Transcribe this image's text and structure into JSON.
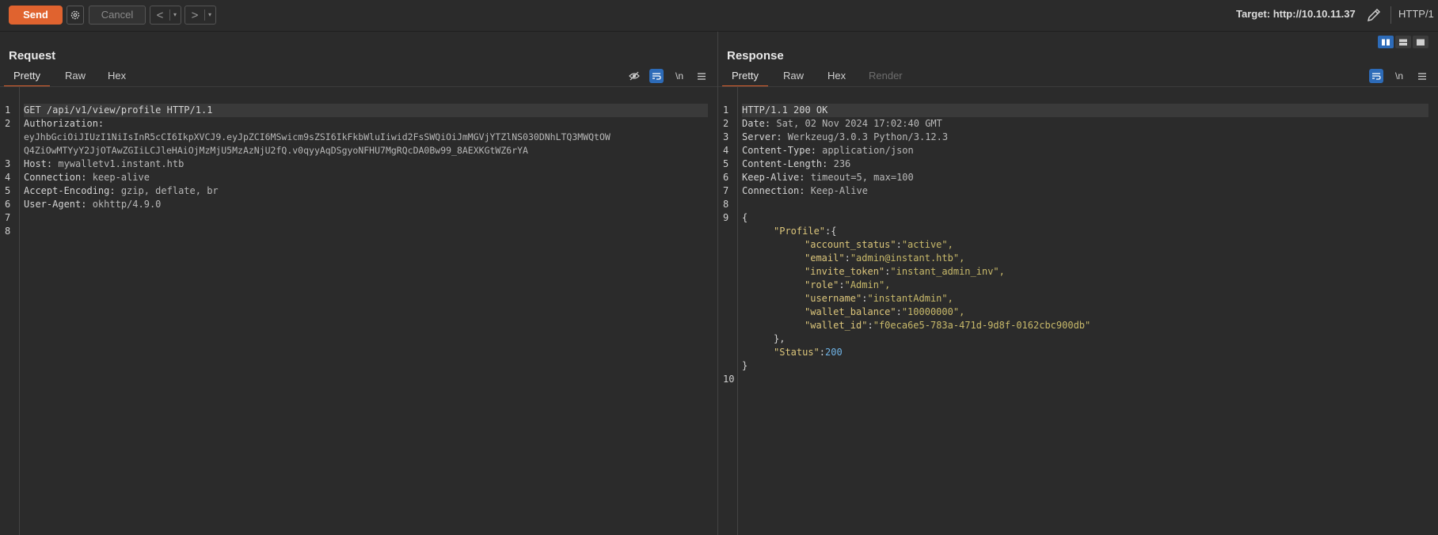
{
  "toolbar": {
    "send": "Send",
    "cancel": "Cancel",
    "back": "<",
    "forward": ">",
    "dropdown": "▾",
    "target": "Target: http://10.10.11.37",
    "protocol": "HTTP/1"
  },
  "request": {
    "title": "Request",
    "tabs": [
      "Pretty",
      "Raw",
      "Hex"
    ],
    "active_tab": "Pretty",
    "newline_label": "\\n",
    "lines": [
      {
        "n": "1",
        "key": "GET /api/v1/view/profile HTTP/1.1",
        "val": ""
      },
      {
        "n": "2",
        "key": "Authorization:",
        "val": ""
      },
      {
        "n": "",
        "key": "",
        "val": "eyJhbGciOiJIUzI1NiIsInR5cCI6IkpXVCJ9.eyJpZCI6MSwicm9sZSI6IkFkbWluIiwid2FsSWQiOiJmMGVjYTZlNS030DNhLTQ3MWQtOW"
      },
      {
        "n": "",
        "key": "",
        "val": "Q4ZiOwMTYyY2JjOTAwZGIiLCJleHAiOjMzMjU5MzAzNjU2fQ.v0qyyAqDSgyoNFHU7MgRQcDA0Bw99_8AEXKGtWZ6rYA"
      },
      {
        "n": "3",
        "key": "Host:",
        "val": " mywalletv1.instant.htb"
      },
      {
        "n": "4",
        "key": "Connection:",
        "val": " keep-alive"
      },
      {
        "n": "5",
        "key": "Accept-Encoding:",
        "val": " gzip, deflate, br"
      },
      {
        "n": "6",
        "key": "User-Agent:",
        "val": " okhttp/4.9.0"
      },
      {
        "n": "7",
        "key": "",
        "val": ""
      },
      {
        "n": "8",
        "key": "",
        "val": ""
      }
    ]
  },
  "response": {
    "title": "Response",
    "tabs": [
      "Pretty",
      "Raw",
      "Hex",
      "Render"
    ],
    "active_tab": "Pretty",
    "newline_label": "\\n",
    "headers": [
      {
        "n": "1",
        "key": "HTTP/1.1 200 OK",
        "val": ""
      },
      {
        "n": "2",
        "key": "Date:",
        "val": " Sat, 02 Nov 2024 17:02:40 GMT"
      },
      {
        "n": "3",
        "key": "Server:",
        "val": " Werkzeug/3.0.3 Python/3.12.3"
      },
      {
        "n": "4",
        "key": "Content-Type:",
        "val": " application/json"
      },
      {
        "n": "5",
        "key": "Content-Length:",
        "val": " 236"
      },
      {
        "n": "6",
        "key": "Keep-Alive:",
        "val": " timeout=5, max=100"
      },
      {
        "n": "7",
        "key": "Connection:",
        "val": " Keep-Alive"
      },
      {
        "n": "8",
        "key": "",
        "val": ""
      }
    ],
    "body": {
      "open": "{",
      "profile_key": "\"Profile\"",
      "profile_open": ":{",
      "fields": [
        {
          "k": "\"account_status\"",
          "v": "\"active\","
        },
        {
          "k": "\"email\"",
          "v": "\"admin@instant.htb\","
        },
        {
          "k": "\"invite_token\"",
          "v": "\"instant_admin_inv\","
        },
        {
          "k": "\"role\"",
          "v": "\"Admin\","
        },
        {
          "k": "\"username\"",
          "v": "\"instantAdmin\","
        },
        {
          "k": "\"wallet_balance\"",
          "v": "\"10000000\","
        },
        {
          "k": "\"wallet_id\"",
          "v": "\"f0eca6e5-783a-471d-9d8f-0162cbc900db\""
        }
      ],
      "profile_close": "},",
      "status_key": "\"Status\"",
      "status_colon": ":",
      "status_value": "200",
      "close": "}",
      "open_line_no": "9",
      "last_line_no": "10"
    }
  },
  "colors": {
    "accent": "#e0632f",
    "selected_blue": "#2d6bb8",
    "json_string": "#c8b96a",
    "json_number": "#6fb3e6"
  }
}
